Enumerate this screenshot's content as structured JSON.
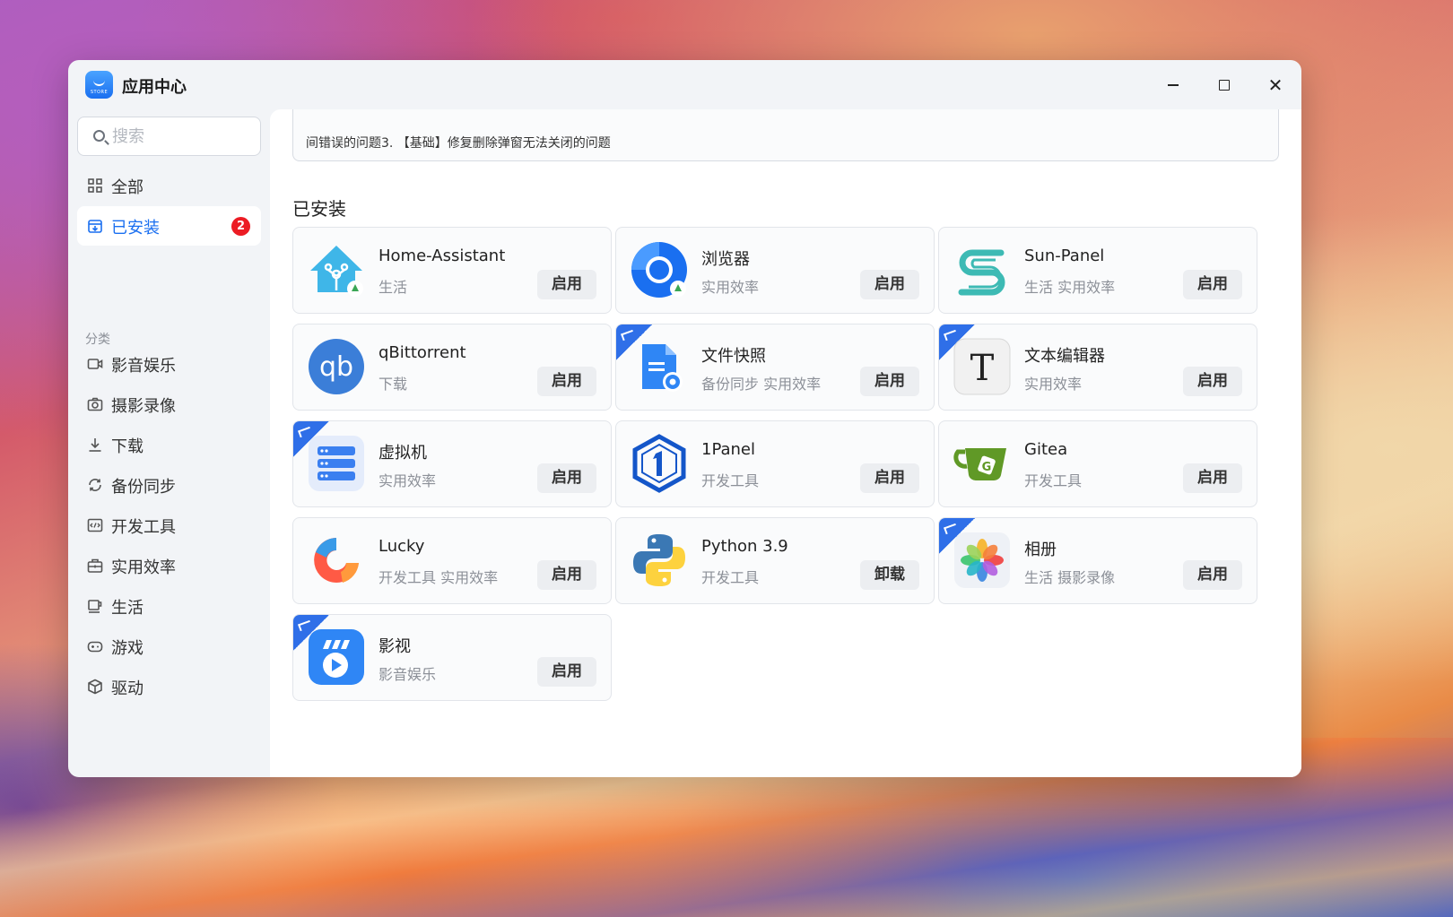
{
  "window": {
    "title": "应用中心"
  },
  "search": {
    "placeholder": "搜索"
  },
  "nav": {
    "all": "全部",
    "installed": "已安装",
    "installed_badge": "2"
  },
  "categories": {
    "title": "分类",
    "items": [
      "影音娱乐",
      "摄影录像",
      "下载",
      "备份同步",
      "开发工具",
      "实用效率",
      "生活",
      "游戏",
      "驱动"
    ]
  },
  "notice": {
    "text": "间错误的问题3. 【基础】修复删除弹窗无法关闭的问题"
  },
  "section": {
    "title": "已安装"
  },
  "apps": [
    {
      "name": "Home-Assistant",
      "tags": "生活",
      "button": "启用",
      "icon": "home-assistant-icon",
      "ribbon": false
    },
    {
      "name": "浏览器",
      "tags": "实用效率",
      "button": "启用",
      "icon": "browser-icon",
      "ribbon": false
    },
    {
      "name": "Sun-Panel",
      "tags": "生活 实用效率",
      "button": "启用",
      "icon": "sun-panel-icon",
      "ribbon": false
    },
    {
      "name": "qBittorrent",
      "tags": "下载",
      "button": "启用",
      "icon": "qbittorrent-icon",
      "ribbon": false
    },
    {
      "name": "文件快照",
      "tags": "备份同步 实用效率",
      "button": "启用",
      "icon": "file-snapshot-icon",
      "ribbon": true
    },
    {
      "name": "文本编辑器",
      "tags": "实用效率",
      "button": "启用",
      "icon": "text-editor-icon",
      "ribbon": true
    },
    {
      "name": "虚拟机",
      "tags": "实用效率",
      "button": "启用",
      "icon": "virtual-machine-icon",
      "ribbon": true
    },
    {
      "name": "1Panel",
      "tags": "开发工具",
      "button": "启用",
      "icon": "1panel-icon",
      "ribbon": false
    },
    {
      "name": "Gitea",
      "tags": "开发工具",
      "button": "启用",
      "icon": "gitea-icon",
      "ribbon": false
    },
    {
      "name": "Lucky",
      "tags": "开发工具 实用效率",
      "button": "启用",
      "icon": "lucky-icon",
      "ribbon": false
    },
    {
      "name": "Python 3.9",
      "tags": "开发工具",
      "button": "卸载",
      "icon": "python-icon",
      "ribbon": false
    },
    {
      "name": "相册",
      "tags": "生活 摄影录像",
      "button": "启用",
      "icon": "photo-album-icon",
      "ribbon": true
    },
    {
      "name": "影视",
      "tags": "影音娱乐",
      "button": "启用",
      "icon": "video-icon",
      "ribbon": true
    }
  ]
}
